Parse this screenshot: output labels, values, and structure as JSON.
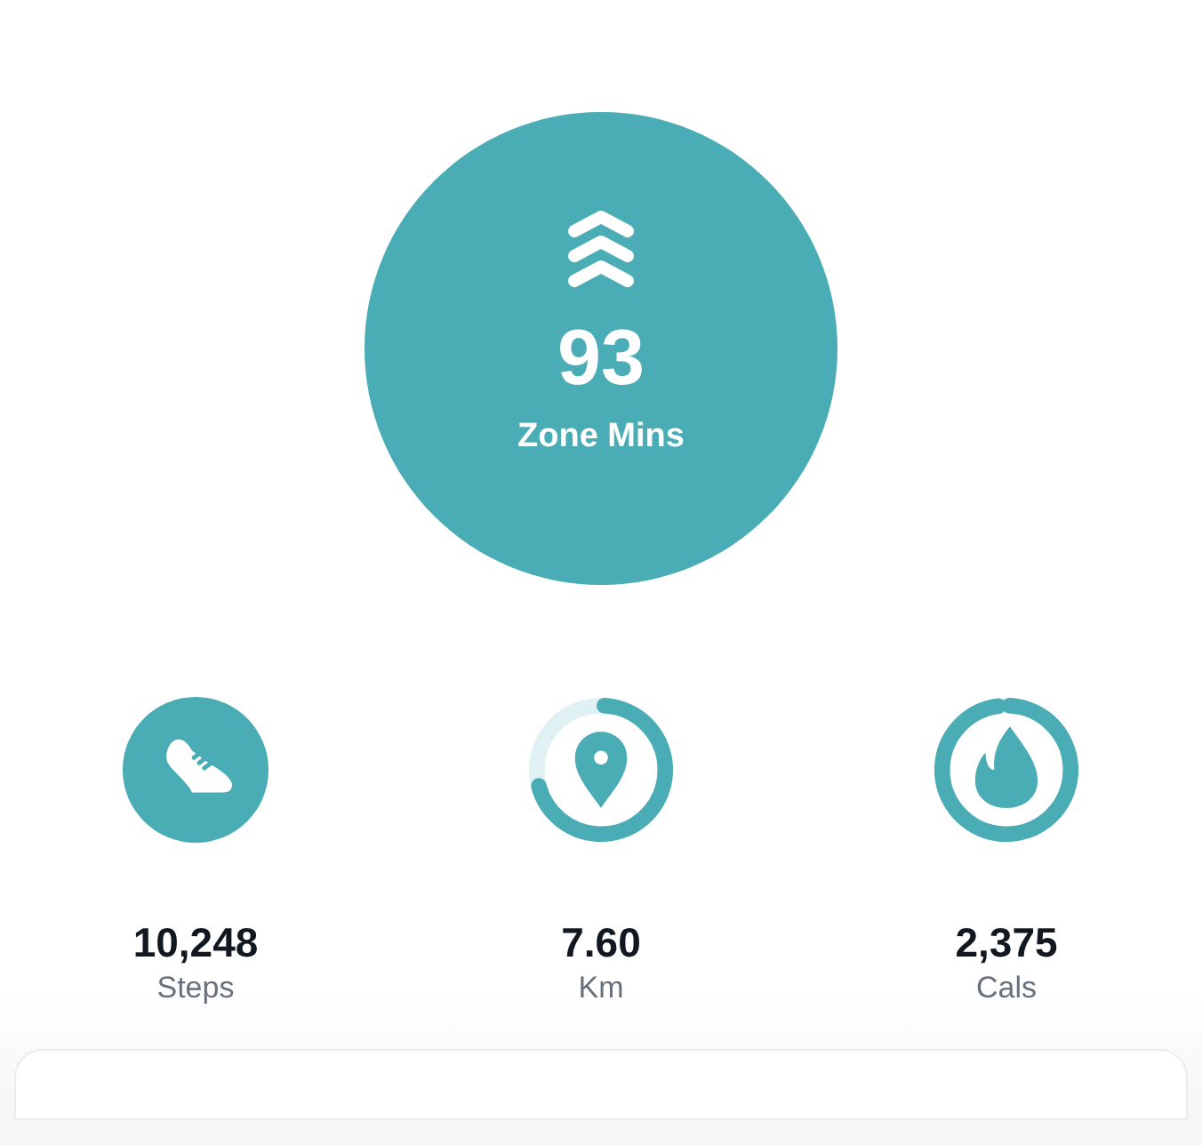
{
  "zone": {
    "value": "93",
    "label": "Zone Mins"
  },
  "stats": [
    {
      "kind": "steps",
      "value": "10,248",
      "label": "Steps"
    },
    {
      "kind": "distance",
      "value": "7.60",
      "label": "Km"
    },
    {
      "kind": "calories",
      "value": "2,375",
      "label": "Cals"
    }
  ]
}
